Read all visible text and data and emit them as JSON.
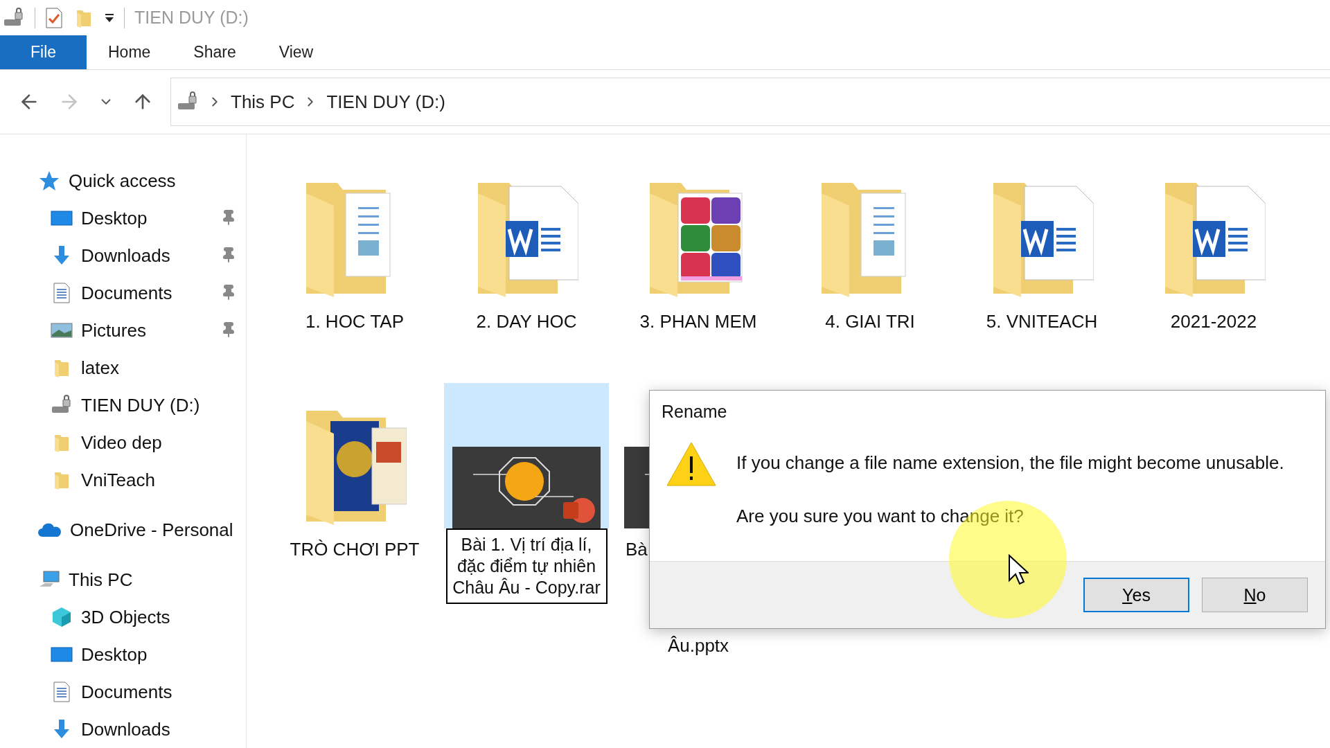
{
  "quick_access_toolbar": {
    "title": "TIEN DUY (D:)"
  },
  "ribbon": {
    "file_tab": "File",
    "tabs": [
      "Home",
      "Share",
      "View"
    ]
  },
  "navigation": {
    "back_disabled": false,
    "forward_disabled": true,
    "breadcrumbs": [
      "This PC",
      "TIEN DUY (D:)"
    ]
  },
  "sidebar": {
    "sections": [
      {
        "label": "Quick access",
        "kind": "star",
        "children": [
          {
            "label": "Desktop",
            "kind": "desktop",
            "pinned": true
          },
          {
            "label": "Downloads",
            "kind": "download",
            "pinned": true
          },
          {
            "label": "Documents",
            "kind": "documents",
            "pinned": true
          },
          {
            "label": "Pictures",
            "kind": "pictures",
            "pinned": true
          },
          {
            "label": "latex",
            "kind": "folder",
            "pinned": false
          },
          {
            "label": "TIEN DUY (D:)",
            "kind": "drive",
            "pinned": false
          },
          {
            "label": "Video dep",
            "kind": "folder",
            "pinned": false
          },
          {
            "label": "VniTeach",
            "kind": "folder",
            "pinned": false
          }
        ]
      },
      {
        "label": "OneDrive - Personal",
        "kind": "cloud"
      },
      {
        "label": "This PC",
        "kind": "pc",
        "children": [
          {
            "label": "3D Objects",
            "kind": "cube",
            "pinned": false
          },
          {
            "label": "Desktop",
            "kind": "desktop",
            "pinned": false
          },
          {
            "label": "Documents",
            "kind": "documents",
            "pinned": false
          },
          {
            "label": "Downloads",
            "kind": "download",
            "pinned": false
          }
        ]
      }
    ]
  },
  "items": [
    {
      "name": "1. HOC TAP",
      "kind": "folder-doc",
      "selected": false
    },
    {
      "name": "2. DAY HOC",
      "kind": "folder-word",
      "selected": false
    },
    {
      "name": "3. PHAN MEM",
      "kind": "folder-archive",
      "selected": false
    },
    {
      "name": "4. GIAI TRI",
      "kind": "folder-doc",
      "selected": false
    },
    {
      "name": "5. VNITEACH",
      "kind": "folder-word",
      "selected": false
    },
    {
      "name": "2021-2022",
      "kind": "folder-word",
      "selected": false
    },
    {
      "name": "TRÒ CHƠI PPT",
      "kind": "folder-game",
      "selected": false
    },
    {
      "name": "Bài 1. Vị trí địa lí, đặc điểm tự nhiên Châu Âu - Copy.rar",
      "kind": "slides",
      "selected": true,
      "renaming": true
    },
    {
      "name": "Bà",
      "name_end": "Âu.pptx",
      "kind": "slides",
      "selected": false
    }
  ],
  "dialog": {
    "title": "Rename",
    "message": [
      "If you change a file name extension, the file might become unusable.",
      "Are you sure you want to change it?"
    ],
    "buttons": [
      {
        "label": "Yes",
        "default": true
      },
      {
        "label": "No",
        "default": false
      }
    ]
  }
}
